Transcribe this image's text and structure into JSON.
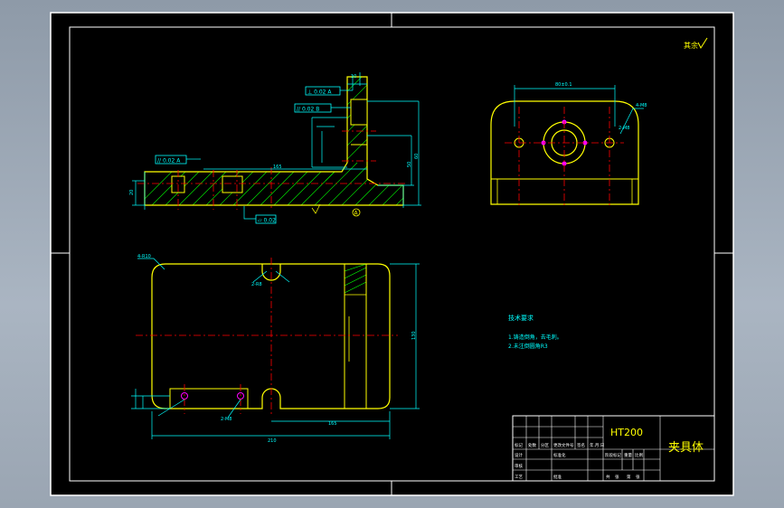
{
  "drawing": {
    "material": "HT200",
    "part_name": "夹具体",
    "corner_mark": "其余",
    "tech_req_title": "技术要求",
    "tech_req_items": [
      "1.铸造倒角，去毛刺。",
      "2.未注倒圆角R3"
    ],
    "dims": {
      "top_width": "80±0.1",
      "hole_callout": "4-M8",
      "side_hole": "2-M8",
      "corner_radius": "4-R10",
      "slot_radius": "2-R8",
      "base_length": "210",
      "inner_length": "165",
      "plan_height": "130",
      "side_height": "50",
      "side_height2": "60",
      "small_dim": "20",
      "small_dim2": "10"
    },
    "gdt": {
      "perp": "⊥ 0.02 A",
      "par1": "// 0.02 B",
      "par2": "// 0.02 A",
      "flat": "▱ 0.02"
    },
    "datum": "A",
    "title_block_labels": [
      "标记",
      "处数",
      "分区",
      "更改文件号",
      "签名",
      "年.月.日",
      "设计",
      "标准化",
      "阶段标记",
      "重量",
      "比例",
      "审核",
      "工艺",
      "批准",
      "共",
      "张",
      "第",
      "张"
    ],
    "colors": {
      "canvas": "#000000",
      "border": "#ffffff",
      "part_outline": "#ffff00",
      "dimension": "#00ffff",
      "center_line": "#ff0000",
      "hatch": "#00ff00",
      "hole": "#ff00ff"
    }
  }
}
